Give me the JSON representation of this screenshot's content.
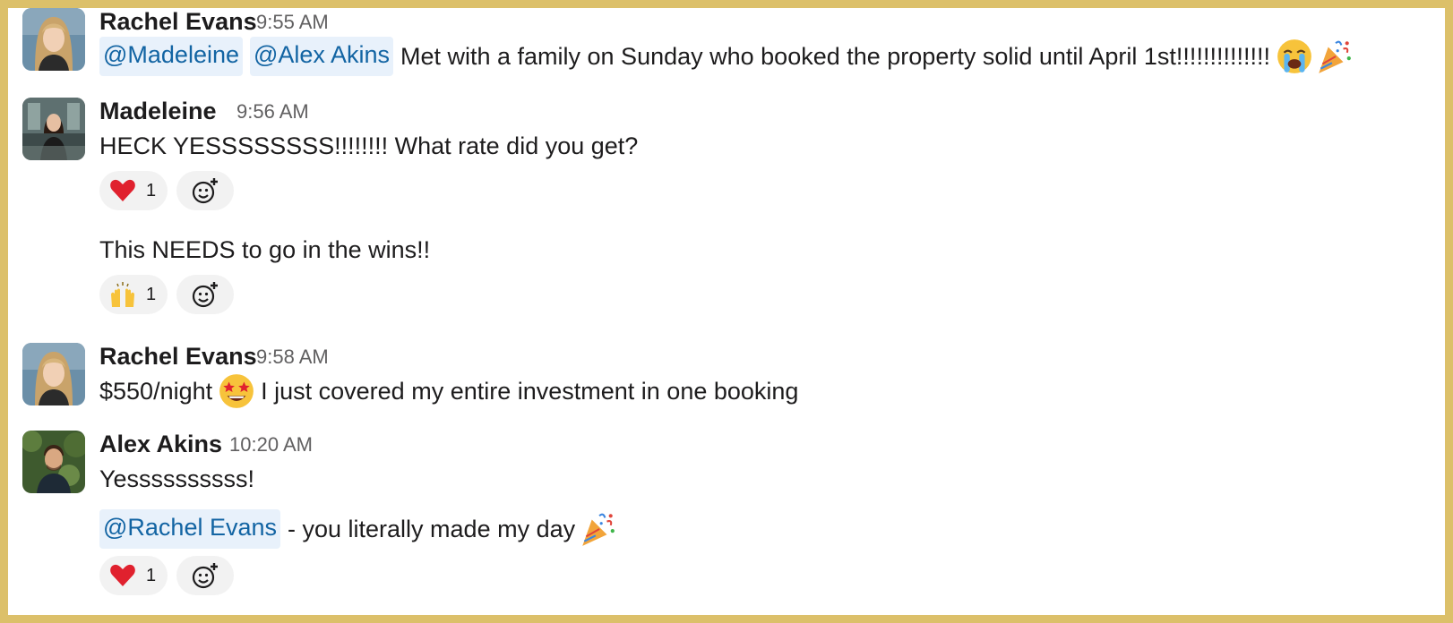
{
  "messages": [
    {
      "author": "Rachel Evans",
      "time": "9:55 AM",
      "mentions": [
        "@Madeleine",
        "@Alex Akins"
      ],
      "text": "Met with a family on Sunday who booked the property solid until April 1st!!!!!!!!!!!!!!",
      "emojis": [
        "loudly-crying-face-emoji",
        "party-popper-emoji"
      ]
    },
    {
      "author": "Madeleine",
      "time": "9:56 AM",
      "text": "HECK YESSSSSSSS!!!!!!!! What rate did you get?",
      "reactions": [
        {
          "emoji": "red-heart",
          "count": "1"
        }
      ],
      "followup": {
        "text": "This NEEDS to go in the wins!!",
        "reactions": [
          {
            "emoji": "raising-hands",
            "count": "1"
          }
        ]
      }
    },
    {
      "author": "Rachel Evans",
      "time": "9:58 AM",
      "text_before": "$550/night",
      "emoji": "star-struck-emoji",
      "text_after": "I just covered my entire investment in one booking"
    },
    {
      "author": "Alex Akins",
      "time": "10:20 AM",
      "text": "Yessssssssss!",
      "followup": {
        "mention": "@Rachel Evans",
        "text": "- you literally made my day",
        "emoji": "party-popper-emoji",
        "reactions": [
          {
            "emoji": "red-heart",
            "count": "1"
          }
        ]
      }
    }
  ],
  "colors": {
    "frame": "#dcc06a",
    "mention_bg": "#e8f1fb",
    "mention_text": "#1264a3",
    "reaction_bg": "#f2f2f2"
  }
}
